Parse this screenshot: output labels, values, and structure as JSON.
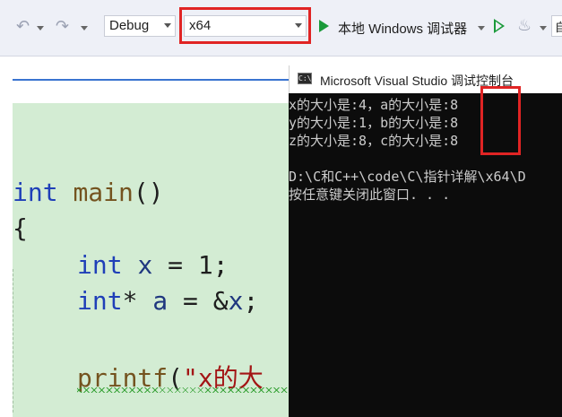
{
  "toolbar": {
    "config_value": "Debug",
    "platform_value": "x64",
    "run_label": "本地 Windows 调试器",
    "edge_label": "自"
  },
  "editor": {
    "lines": {
      "l1_kw": "int",
      "l1_fn": "main",
      "l1_rest": "()",
      "l2": "{",
      "l3_kw": "int",
      "l3_id": "x",
      "l3_rest": " = 1;",
      "l4_kw": "int",
      "l4_op": "* ",
      "l4_id": "a",
      "l4_mid": " = &",
      "l4_id2": "x",
      "l4_end": ";",
      "l5_fn": "printf",
      "l5_paren": "(",
      "l5_str": "\"x的大"
    }
  },
  "console": {
    "icon_text": "C:\\",
    "title": "Microsoft Visual Studio 调试控制台",
    "lines": [
      "x的大小是:4，a的大小是:8",
      "y的大小是:1，b的大小是:8",
      "z的大小是:8，c的大小是:8",
      "",
      "D:\\C和C++\\code\\C\\指针详解\\x64\\D",
      "按任意键关闭此窗口. . ."
    ]
  },
  "colors": {
    "highlight_box": "#e02424",
    "editor_bg": "#d3ecd3",
    "console_bg": "#0c0c0c",
    "run_green": "#1a9a3a"
  }
}
